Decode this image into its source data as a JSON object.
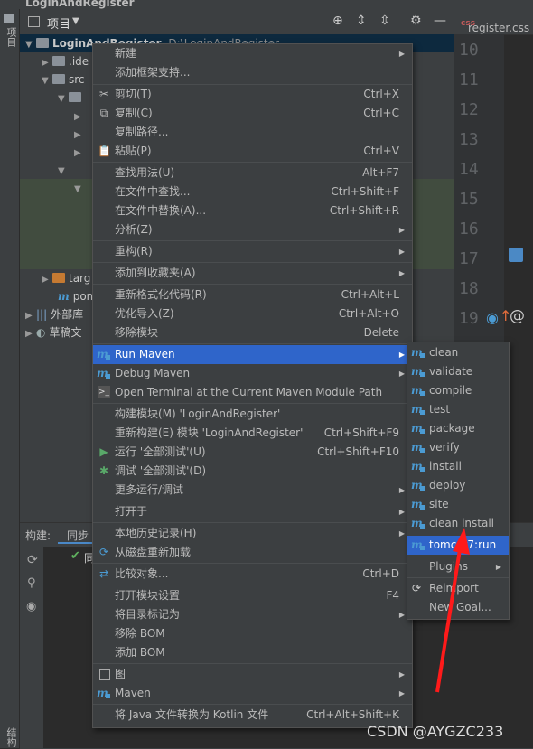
{
  "window": {
    "title": "LoginAndRegister"
  },
  "left_strip": {
    "project_tab": "项目",
    "structure_tab": "结构"
  },
  "project_panel": {
    "title": "项目",
    "root_name": "LoginAndRegister",
    "root_path": "D:\\LoginAndRegister",
    "items": [
      {
        "label": ".ide"
      },
      {
        "label": "src"
      },
      {
        "label": "targ"
      },
      {
        "label": "pom"
      },
      {
        "label": "外部库"
      },
      {
        "label": "草稿文"
      }
    ]
  },
  "editor": {
    "tab_label": "register.css",
    "line_numbers": [
      "10",
      "11",
      "12",
      "13",
      "14",
      "15",
      "16",
      "17",
      "18",
      "19"
    ]
  },
  "build_panel": {
    "tabs": [
      "构建:",
      "同步"
    ],
    "row_prefix": "同"
  },
  "context_menu": {
    "items": [
      {
        "label": "新建",
        "shortcut": "",
        "submenu": true
      },
      {
        "label": "添加框架支持...",
        "shortcut": "",
        "submenu": false
      },
      {
        "label": "剪切(T)",
        "shortcut": "Ctrl+X",
        "submenu": false
      },
      {
        "label": "复制(C)",
        "shortcut": "Ctrl+C",
        "submenu": false
      },
      {
        "label": "复制路径...",
        "shortcut": "",
        "submenu": false
      },
      {
        "label": "粘贴(P)",
        "shortcut": "Ctrl+V",
        "submenu": false
      },
      {
        "label": "查找用法(U)",
        "shortcut": "Alt+F7",
        "submenu": false
      },
      {
        "label": "在文件中查找...",
        "shortcut": "Ctrl+Shift+F",
        "submenu": false
      },
      {
        "label": "在文件中替换(A)...",
        "shortcut": "Ctrl+Shift+R",
        "submenu": false
      },
      {
        "label": "分析(Z)",
        "shortcut": "",
        "submenu": true
      },
      {
        "label": "重构(R)",
        "shortcut": "",
        "submenu": true
      },
      {
        "label": "添加到收藏夹(A)",
        "shortcut": "",
        "submenu": true
      },
      {
        "label": "重新格式化代码(R)",
        "shortcut": "Ctrl+Alt+L",
        "submenu": false
      },
      {
        "label": "优化导入(Z)",
        "shortcut": "Ctrl+Alt+O",
        "submenu": false
      },
      {
        "label": "移除模块",
        "shortcut": "Delete",
        "submenu": false
      },
      {
        "label": "Run Maven",
        "shortcut": "",
        "submenu": true
      },
      {
        "label": "Debug Maven",
        "shortcut": "",
        "submenu": true
      },
      {
        "label": "Open Terminal at the Current Maven Module Path",
        "shortcut": "",
        "submenu": false
      },
      {
        "label": "构建模块(M) 'LoginAndRegister'",
        "shortcut": "",
        "submenu": false
      },
      {
        "label": "重新构建(E) 模块 'LoginAndRegister'",
        "shortcut": "Ctrl+Shift+F9",
        "submenu": false
      },
      {
        "label": "运行 '全部测试'(U)",
        "shortcut": "Ctrl+Shift+F10",
        "submenu": false
      },
      {
        "label": "调试 '全部测试'(D)",
        "shortcut": "",
        "submenu": false
      },
      {
        "label": "更多运行/调试",
        "shortcut": "",
        "submenu": true
      },
      {
        "label": "打开于",
        "shortcut": "",
        "submenu": true
      },
      {
        "label": "本地历史记录(H)",
        "shortcut": "",
        "submenu": true
      },
      {
        "label": "从磁盘重新加载",
        "shortcut": "",
        "submenu": false
      },
      {
        "label": "比较对象...",
        "shortcut": "Ctrl+D",
        "submenu": false
      },
      {
        "label": "打开模块设置",
        "shortcut": "F4",
        "submenu": false
      },
      {
        "label": "将目录标记为",
        "shortcut": "",
        "submenu": true
      },
      {
        "label": "移除 BOM",
        "shortcut": "",
        "submenu": false
      },
      {
        "label": "添加 BOM",
        "shortcut": "",
        "submenu": false
      },
      {
        "label": "图",
        "shortcut": "",
        "submenu": true
      },
      {
        "label": "Maven",
        "shortcut": "",
        "submenu": true
      },
      {
        "label": "将 Java 文件转换为 Kotlin 文件",
        "shortcut": "Ctrl+Alt+Shift+K",
        "submenu": false
      }
    ]
  },
  "maven_submenu": {
    "items": [
      {
        "label": "clean"
      },
      {
        "label": "validate"
      },
      {
        "label": "compile"
      },
      {
        "label": "test"
      },
      {
        "label": "package"
      },
      {
        "label": "verify"
      },
      {
        "label": "install"
      },
      {
        "label": "deploy"
      },
      {
        "label": "site"
      },
      {
        "label": "clean install"
      },
      {
        "label": "tomcat7:run"
      },
      {
        "label": "Plugins"
      },
      {
        "label": "Reimport"
      },
      {
        "label": "New Goal..."
      }
    ]
  },
  "watermark": "CSDN @AYGZC233",
  "colors": {
    "highlight": "#2f65ca",
    "menu_bg": "#3c3f41",
    "editor_bg": "#2b2b2b",
    "arrow": "#ff1a1a",
    "maven_icon": "#4b9bd3"
  }
}
